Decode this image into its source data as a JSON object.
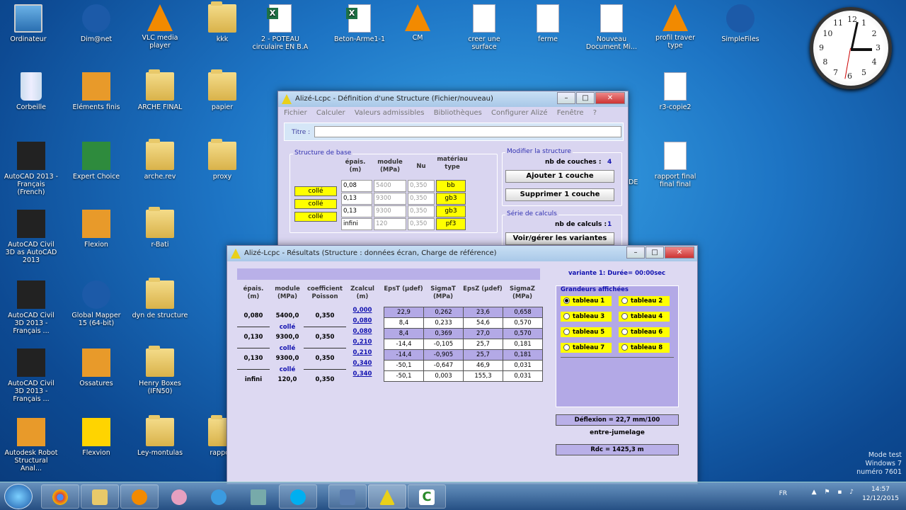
{
  "desktop": {
    "icons": [
      {
        "label": "Ordinateur",
        "kind": "pc"
      },
      {
        "label": "Dim@net",
        "kind": "blue"
      },
      {
        "label": "VLC media player",
        "kind": "vlc"
      },
      {
        "label": "kkk",
        "kind": "folder"
      },
      {
        "label": "2 - POTEAU circulaire EN B.A",
        "kind": "excel"
      },
      {
        "label": "Beton-Arme1-1",
        "kind": "excel"
      },
      {
        "label": "CM",
        "kind": "vlc"
      },
      {
        "label": "creer une surface",
        "kind": "doc"
      },
      {
        "label": "ferme",
        "kind": "doc"
      },
      {
        "label": "Nouveau Document Mi...",
        "kind": "doc"
      },
      {
        "label": "profil traver type",
        "kind": "vlc"
      },
      {
        "label": "SimpleFiles",
        "kind": "blue"
      },
      {
        "label": "Corbeille",
        "kind": "bin"
      },
      {
        "label": "Eléments finis",
        "kind": "orange"
      },
      {
        "label": "ARCHE FINAL",
        "kind": "folder"
      },
      {
        "label": "papier",
        "kind": "folder"
      },
      {
        "label": "r3-copie2",
        "kind": "doc"
      },
      {
        "label": "AutoCAD 2013 - Français (French)",
        "kind": "cad"
      },
      {
        "label": "Expert Choice",
        "kind": "green"
      },
      {
        "label": "arche.rev",
        "kind": "folder"
      },
      {
        "label": "proxy",
        "kind": "folder"
      },
      {
        "label": "rapport final final final",
        "kind": "doc"
      },
      {
        "label": "AutoCAD Civil 3D as AutoCAD 2013",
        "kind": "cad"
      },
      {
        "label": "Flexion",
        "kind": "orange"
      },
      {
        "label": "r-Bati",
        "kind": "folder"
      },
      {
        "label": "AutoCAD Civil 3D 2013 - Français ...",
        "kind": "cad"
      },
      {
        "label": "Global Mapper 15 (64-bit)",
        "kind": "blue"
      },
      {
        "label": "dyn de structure",
        "kind": "folder"
      },
      {
        "label": "AutoCAD Civil 3D 2013 - Français ...",
        "kind": "cad"
      },
      {
        "label": "Ossatures",
        "kind": "orange"
      },
      {
        "label": "Henry Boxes (IFN50)",
        "kind": "folder"
      },
      {
        "label": "Autodesk Robot Structural Anal...",
        "kind": "orange"
      },
      {
        "label": "Flexvion",
        "kind": "yellow"
      },
      {
        "label": "Ley-montulas",
        "kind": "folder"
      },
      {
        "label": "rapport",
        "kind": "folder"
      }
    ],
    "clock_numbers": [
      "12",
      "1",
      "2",
      "3",
      "4",
      "5",
      "6",
      "7",
      "8",
      "9",
      "10",
      "11"
    ]
  },
  "win1": {
    "title": "Alizé-Lcpc - Définition d'une Structure (Fichier/nouveau)",
    "menu": [
      "Fichier",
      "Calculer",
      "Valeurs admissibles",
      "Bibliothèques",
      "Configurer Alizé",
      "Fenêtre",
      "?"
    ],
    "titre_label": "Titre :",
    "base_group": "Structure de base",
    "headers": {
      "epais": "épais. (m)",
      "module": "module (MPa)",
      "nu": "Nu",
      "materiau": "matériau type"
    },
    "rows": [
      {
        "epais": "0,08",
        "module": "5400",
        "nu": "0,350",
        "mat": "bb"
      },
      {
        "epais": "0,13",
        "module": "9300",
        "nu": "0,350",
        "mat": "gb3"
      },
      {
        "epais": "0,13",
        "module": "9300",
        "nu": "0,350",
        "mat": "gb3"
      },
      {
        "epais": "infini",
        "module": "120",
        "nu": "0,350",
        "mat": "pf3"
      }
    ],
    "interfaces": [
      "collé",
      "collé",
      "collé"
    ],
    "modify_group": "Modifier la structure",
    "nb_couches_label": "nb de couches :",
    "nb_couches": "4",
    "add_btn": "Ajouter 1 couche",
    "del_btn": "Supprimer 1 couche",
    "serie_group": "Série de calculs",
    "nb_calculs_label": "nb de calculs :",
    "nb_calculs": "1",
    "variants_btn": "Voir/gérer les variantes",
    "side_text": "DE"
  },
  "win2": {
    "title": "Alizé-Lcpc - Résultats (Structure : données écran, Charge de référence)",
    "headers": [
      "épais. (m)",
      "module (MPa)",
      "coefficient Poisson",
      "Zcalcul (m)",
      "EpsT (µdef)",
      "SigmaT (MPa)",
      "EpsZ (µdef)",
      "SigmaZ (MPa)"
    ],
    "layers": [
      {
        "epais": "0,080",
        "module": "5400,0",
        "poisson": "0,350",
        "interface": "collé"
      },
      {
        "epais": "0,130",
        "module": "9300,0",
        "poisson": "0,350",
        "interface": "collé"
      },
      {
        "epais": "0,130",
        "module": "9300,0",
        "poisson": "0,350",
        "interface": "collé"
      },
      {
        "epais": "infini",
        "module": "120,0",
        "poisson": "0,350",
        "interface": ""
      }
    ],
    "zcalc": [
      "0,000",
      "0,080",
      "0,080",
      "0,210",
      "0,210",
      "0,340",
      "0,340"
    ],
    "results": [
      [
        "22,9",
        "0,262",
        "23,6",
        "0,658"
      ],
      [
        "8,4",
        "0,233",
        "54,6",
        "0,570"
      ],
      [
        "8,4",
        "0,369",
        "27,0",
        "0,570"
      ],
      [
        "-14,4",
        "-0,105",
        "25,7",
        "0,181"
      ],
      [
        "-14,4",
        "-0,905",
        "25,7",
        "0,181"
      ],
      [
        "-50,1",
        "-0,647",
        "46,9",
        "0,031"
      ],
      [
        "-50,1",
        "0,003",
        "155,3",
        "0,031"
      ]
    ],
    "variante": "variante 1:  Durée= 00:00sec",
    "grandeurs": "Grandeurs affichées",
    "tableaux": [
      "tableau 1",
      "tableau 2",
      "tableau 3",
      "tableau 4",
      "tableau 5",
      "tableau 6",
      "tableau 7",
      "tableau 8"
    ],
    "deflexion": "Déflexion = 22,7 mm/100",
    "entre": "entre-jumelage",
    "rdc": "Rdc = 1425,3 m"
  },
  "taskbar": {
    "lang": "FR",
    "time": "14:57",
    "date": "12/12/2015"
  },
  "watermark": {
    "line1": "Mode test",
    "line2": "Windows 7",
    "line3": "numéro 7601"
  }
}
